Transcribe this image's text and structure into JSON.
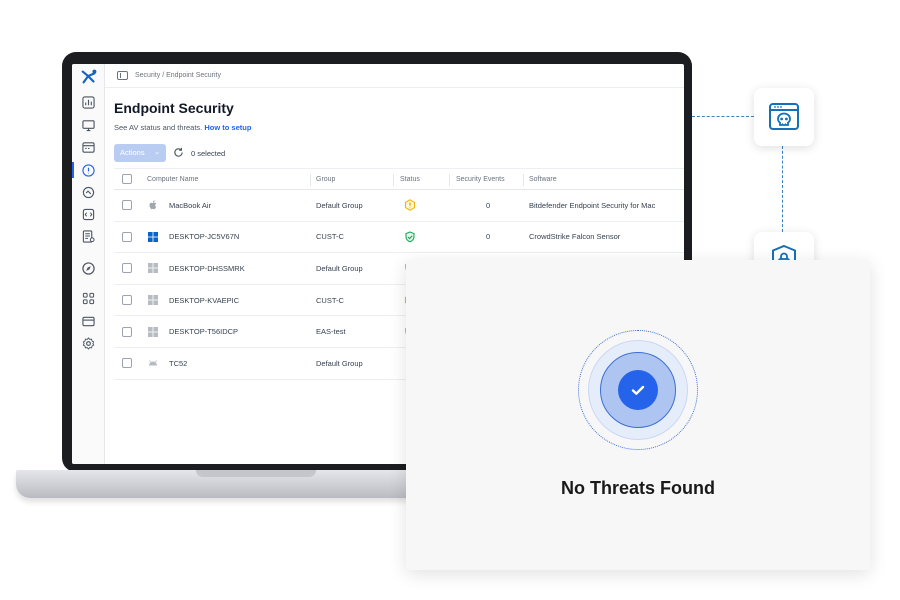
{
  "app": {
    "breadcrumb": "Security / Endpoint Security",
    "title": "Endpoint Security",
    "subtitle": "See AV status and threats.",
    "setup_link": "How to setup"
  },
  "toolbar": {
    "actions_label": "Actions",
    "selected_label": "0 selected"
  },
  "table": {
    "headers": [
      "Computer Name",
      "Group",
      "Status",
      "Security Events",
      "Software"
    ],
    "rows": [
      {
        "name": "MacBook Air",
        "group": "Default Group",
        "events": "0",
        "software": "Bitdefender Endpoint Security for Mac",
        "os": "apple-icon",
        "status": "warning"
      },
      {
        "name": "DESKTOP-JC5V67N",
        "group": "CUST-C",
        "events": "0",
        "software": "CrowdStrike Falcon Sensor",
        "os": "windows-icon",
        "status": "ok"
      },
      {
        "name": "DESKTOP-DHSSMRK",
        "group": "Default Group",
        "events": "",
        "software": "",
        "os": "windows-icon",
        "status": "ok"
      },
      {
        "name": "DESKTOP-KVAEPIC",
        "group": "CUST-C",
        "events": "",
        "software": "",
        "os": "windows-icon",
        "status": "warning"
      },
      {
        "name": "DESKTOP-T56IDCP",
        "group": "EAS-test",
        "events": "",
        "software": "",
        "os": "windows-icon",
        "status": "ok"
      },
      {
        "name": "TC52",
        "group": "Default Group",
        "events": "",
        "software": "",
        "os": "android-icon",
        "status": "none"
      }
    ]
  },
  "result": {
    "message": "No Threats Found"
  },
  "colors": {
    "accent": "#2563eb",
    "warning": "#f5b400",
    "ok": "#22a55b",
    "brand": "#1670b8"
  }
}
